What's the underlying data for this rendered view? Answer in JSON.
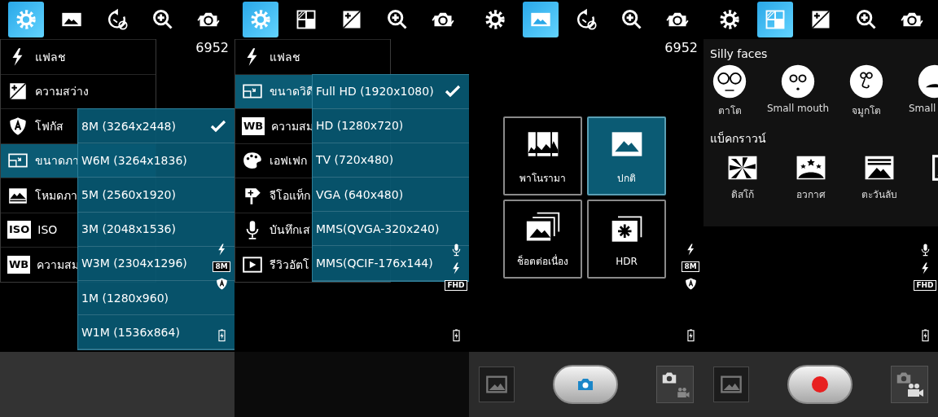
{
  "panels": [
    {
      "kind": "menu",
      "toolbar": [
        {
          "kind": "settings",
          "selected": true
        },
        {
          "kind": "landscape",
          "selected": false
        },
        {
          "kind": "timer",
          "selected": false
        },
        {
          "kind": "zoom",
          "selected": false
        },
        {
          "kind": "switch",
          "selected": false
        }
      ],
      "counter": "6952",
      "menu": [
        {
          "kind": "flash",
          "label": "แฟลช",
          "selected": false
        },
        {
          "kind": "exposure",
          "label": "ความสว่าง",
          "selected": false
        },
        {
          "kind": "focus",
          "label": "โฟกัส",
          "selected": false
        },
        {
          "kind": "size",
          "label": "ขนาดภา",
          "selected": true
        },
        {
          "kind": "mode",
          "label": "โหมดภา",
          "selected": false
        },
        {
          "kind": "badge",
          "badge": "ISO",
          "label": "ISO",
          "selected": false
        },
        {
          "kind": "badge",
          "badge": "WB",
          "label": "ความสม",
          "selected": false
        }
      ],
      "popup": [
        {
          "label": "8M (3264x2448)",
          "checked": true
        },
        {
          "label": "W6M (3264x1836)",
          "checked": false
        },
        {
          "label": "5M (2560x1920)",
          "checked": false
        },
        {
          "label": "3M (2048x1536)",
          "checked": false
        },
        {
          "label": "W3M (2304x1296)",
          "checked": false
        },
        {
          "label": "1M (1280x960)",
          "checked": false
        },
        {
          "label": "W1M (1536x864)",
          "checked": false
        }
      ],
      "status": [
        {
          "kind": "flash"
        },
        {
          "kind": "badge",
          "badge": "8M"
        },
        {
          "kind": "focus"
        },
        {
          "kind": "battery"
        }
      ]
    },
    {
      "kind": "menu",
      "toolbar": [
        {
          "kind": "settings",
          "selected": true
        },
        {
          "kind": "grid",
          "selected": false
        },
        {
          "kind": "exposure",
          "selected": false
        },
        {
          "kind": "zoom",
          "selected": false
        },
        {
          "kind": "switch",
          "selected": false
        }
      ],
      "menu": [
        {
          "kind": "flash",
          "label": "แฟลช",
          "selected": false
        },
        {
          "kind": "size",
          "label": "ขนาดวิดี",
          "selected": true
        },
        {
          "kind": "badge",
          "badge": "WB",
          "label": "ความสม",
          "selected": false
        },
        {
          "kind": "palette",
          "label": "เอฟเฟก",
          "selected": false
        },
        {
          "kind": "geotag",
          "label": "จีโอแท็ก",
          "selected": false
        },
        {
          "kind": "mic",
          "label": "บันทึกเส",
          "selected": false
        },
        {
          "kind": "play",
          "label": "รีวิวอัตโ",
          "selected": false
        }
      ],
      "popup": [
        {
          "label": "Full HD (1920x1080)",
          "checked": true
        },
        {
          "label": "HD (1280x720)",
          "checked": false
        },
        {
          "label": "TV (720x480)",
          "checked": false
        },
        {
          "label": "VGA (640x480)",
          "checked": false
        },
        {
          "label": "MMS(QVGA-320x240)",
          "checked": false
        },
        {
          "label": "MMS(QCIF-176x144)",
          "checked": false
        }
      ],
      "status": [
        {
          "kind": "mic"
        },
        {
          "kind": "flash"
        },
        {
          "kind": "badge",
          "badge": "FHD"
        },
        {
          "kind": "battery"
        }
      ]
    },
    {
      "kind": "modes",
      "toolbar": [
        {
          "kind": "settings",
          "selected": false
        },
        {
          "kind": "landscape",
          "selected": true
        },
        {
          "kind": "timer",
          "selected": false
        },
        {
          "kind": "zoom",
          "selected": false
        },
        {
          "kind": "switch",
          "selected": false
        }
      ],
      "counter": "6952",
      "modes": [
        {
          "kind": "panorama",
          "label": "พาโนรามา",
          "selected": false
        },
        {
          "kind": "single",
          "label": "ปกติ",
          "selected": true
        },
        {
          "kind": "burst",
          "label": "ช็อตต่อเนื่อง",
          "selected": false
        },
        {
          "kind": "hdr",
          "label": "HDR",
          "selected": false
        }
      ],
      "status": [
        {
          "kind": "flash"
        },
        {
          "kind": "badge",
          "badge": "8M"
        },
        {
          "kind": "focus"
        },
        {
          "kind": "battery"
        }
      ],
      "bottom_bar": {
        "video": false
      }
    },
    {
      "kind": "effects",
      "toolbar": [
        {
          "kind": "settings",
          "selected": false
        },
        {
          "kind": "grid",
          "selected": true
        },
        {
          "kind": "exposure",
          "selected": false
        },
        {
          "kind": "zoom",
          "selected": false
        },
        {
          "kind": "switch",
          "selected": false
        }
      ],
      "sections": [
        {
          "title": "Silly faces",
          "kind": "faces",
          "items": [
            {
              "kind": "eyes",
              "label": "ตาโต"
            },
            {
              "kind": "mouth",
              "label": "Small mouth"
            },
            {
              "kind": "nose",
              "label": "จมูกโต"
            },
            {
              "kind": "eyes2",
              "label": "Small"
            }
          ]
        },
        {
          "title": "แบ็คกราวน์",
          "kind": "backgrounds",
          "items": [
            {
              "kind": "disco",
              "label": "ดิสโก้"
            },
            {
              "kind": "space",
              "label": "อวกาศ"
            },
            {
              "kind": "sunset",
              "label": "ตะวันลับ"
            },
            {
              "kind": "frame"
            }
          ]
        }
      ],
      "status": [
        {
          "kind": "mic"
        },
        {
          "kind": "flash"
        },
        {
          "kind": "badge",
          "badge": "FHD"
        },
        {
          "kind": "battery"
        }
      ],
      "bottom_bar": {
        "video": true
      }
    }
  ]
}
